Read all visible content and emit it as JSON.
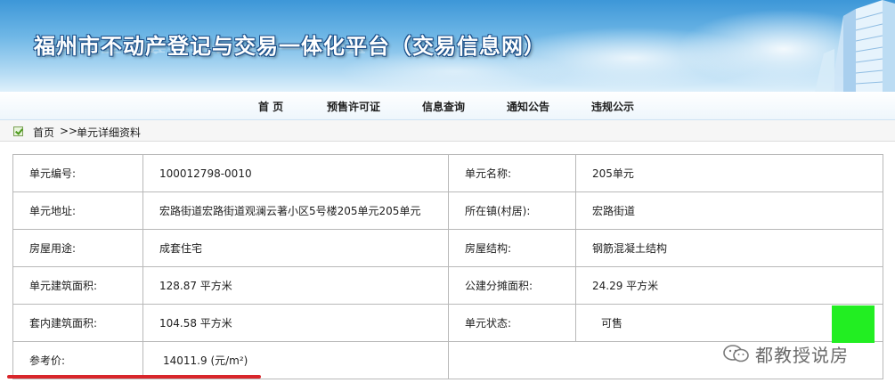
{
  "banner": {
    "title": "福州市不动产登记与交易一体化平台（交易信息网）"
  },
  "nav": {
    "items": [
      {
        "label": "首 页"
      },
      {
        "label": "预售许可证"
      },
      {
        "label": "信息查询"
      },
      {
        "label": "通知公告"
      },
      {
        "label": "违规公示"
      }
    ]
  },
  "breadcrumb": {
    "home": "首页",
    "separator": ">>",
    "current": "单元详细资料"
  },
  "detail": {
    "unit_no_label": "单元编号:",
    "unit_no": "100012798-0010",
    "unit_name_label": "单元名称:",
    "unit_name": "205单元",
    "address_label": "单元地址:",
    "address": "宏路街道宏路街道观澜云著小区5号楼205单元205单元",
    "town_label": "所在镇(村居):",
    "town": "宏路街道",
    "usage_label": "房屋用途:",
    "usage": "成套住宅",
    "structure_label": "房屋结构:",
    "structure": "钢筋混凝土结构",
    "build_area_label": "单元建筑面积:",
    "build_area": "128.87 平方米",
    "shared_area_label": "公建分摊面积:",
    "shared_area": "24.29 平方米",
    "inner_area_label": "套内建筑面积:",
    "inner_area": "104.58 平方米",
    "status_label": "单元状态:",
    "status": "可售",
    "price_label": "参考价:",
    "price": "14011.9 (元/m²)"
  },
  "watermark": {
    "text": "都教授说房"
  },
  "colors": {
    "status_indicator": "#22ee22",
    "highlight_underline": "#d9262b"
  }
}
